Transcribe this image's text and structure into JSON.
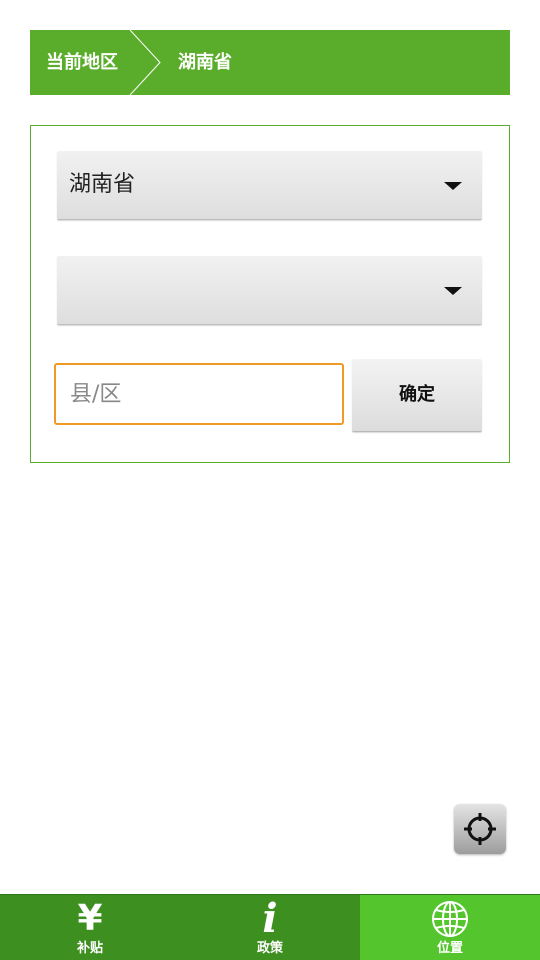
{
  "breadcrumb": {
    "current_label": "当前地区",
    "value": "湖南省"
  },
  "form": {
    "province_select": {
      "selected": "湖南省"
    },
    "city_select": {
      "selected": ""
    },
    "county_input": {
      "value": "",
      "placeholder": "县/区"
    },
    "confirm_label": "确定"
  },
  "colors": {
    "brand_green": "#5aad2a",
    "tabbar_green": "#3d8f1f",
    "active_tab_green": "#55c52d",
    "input_focus_orange": "#ef9a24"
  },
  "locate_button": {
    "icon": "crosshair-icon"
  },
  "tabbar": {
    "tabs": [
      {
        "label": "补贴",
        "icon": "yen-icon",
        "active": false
      },
      {
        "label": "政策",
        "icon": "info-icon",
        "active": false
      },
      {
        "label": "位置",
        "icon": "globe-icon",
        "active": true
      }
    ]
  }
}
